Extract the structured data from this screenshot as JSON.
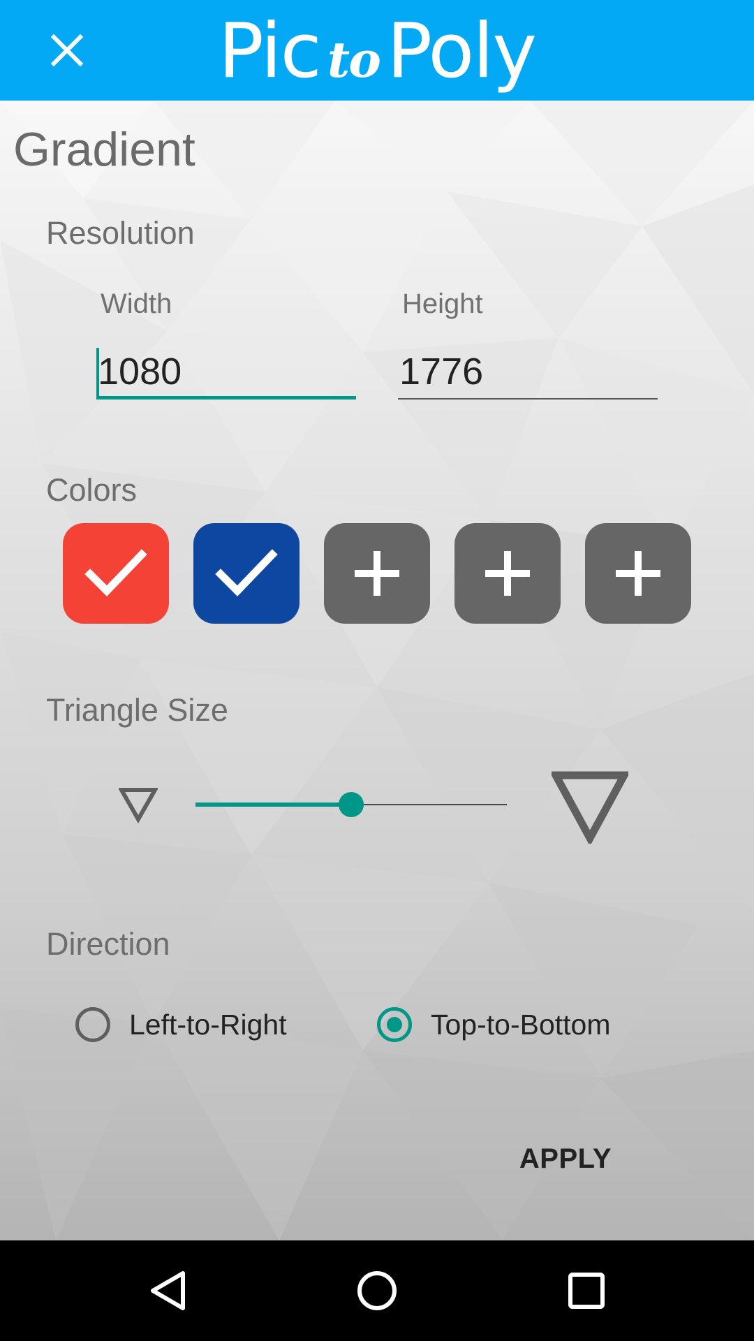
{
  "app": {
    "title_part1": "Pic",
    "title_part2": "to",
    "title_part3": "Poly",
    "bar_color": "#03A9F4"
  },
  "toolbar": {
    "close_icon": "close-icon"
  },
  "screen": {
    "title": "Gradient"
  },
  "resolution": {
    "label": "Resolution",
    "width_label": "Width",
    "width_value": "1080",
    "height_label": "Height",
    "height_value": "1776"
  },
  "colors": {
    "label": "Colors",
    "swatches": [
      {
        "color": "#F44336",
        "state": "selected",
        "icon": "check-icon"
      },
      {
        "color": "#0D47A1",
        "state": "selected",
        "icon": "check-icon"
      },
      {
        "color": "#666666",
        "state": "add",
        "icon": "plus-icon"
      },
      {
        "color": "#666666",
        "state": "add",
        "icon": "plus-icon"
      },
      {
        "color": "#666666",
        "state": "add",
        "icon": "plus-icon"
      }
    ]
  },
  "triangle_size": {
    "label": "Triangle Size",
    "min_icon": "small-triangle-icon",
    "max_icon": "large-triangle-icon",
    "value_fraction": 0.5
  },
  "direction": {
    "label": "Direction",
    "options": [
      {
        "label": "Left-to-Right",
        "selected": false
      },
      {
        "label": "Top-to-Bottom",
        "selected": true
      }
    ]
  },
  "actions": {
    "apply_label": "APPLY"
  },
  "accent_color": "#009688",
  "navbar": {
    "buttons": [
      "back-icon",
      "home-icon",
      "recents-icon"
    ]
  }
}
